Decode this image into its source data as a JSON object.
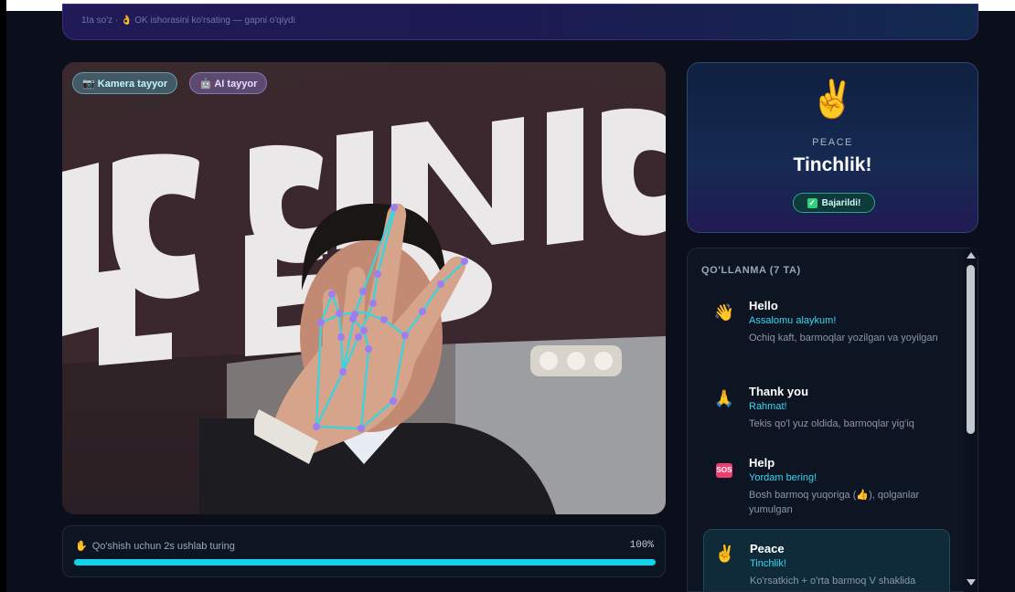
{
  "banner": {
    "text": "1ta so'z · 👌 OK ishorasini ko'rsating — gapni o'qiydi"
  },
  "camera": {
    "status_camera": "📷 Kamera tayyor",
    "status_ai": "🤖 AI tayyor"
  },
  "hold": {
    "icon": "✋",
    "label": "Qo'shish uchun 2s ushlab turing",
    "percent_text": "100%",
    "progress": 1.0,
    "bar_color": "#10d4ea"
  },
  "result": {
    "emoji": "✌️",
    "english": "PEACE",
    "uzbek": "Tinchlik!",
    "badge": "Bajarildi!"
  },
  "guide": {
    "title": "QO'LLANMA (7 TA)",
    "items": [
      {
        "icon": "👋",
        "english": "Hello",
        "uzbek": "Assalomu alaykum!",
        "desc": "Ochiq kaft, barmoqlar yozilgan va yoyilgan"
      },
      {
        "icon": "🙏",
        "english": "Thank you",
        "uzbek": "Rahmat!",
        "desc": "Tekis qo'l yuz oldida, barmoqlar yig'iq"
      },
      {
        "icon": "SOS",
        "english": "Help",
        "uzbek": "Yordam bering!",
        "desc": "Bosh barmoq yuqoriga (👍), qolganlar yumulgan"
      },
      {
        "icon": "✌️",
        "english": "Peace",
        "uzbek": "Tinchlik!",
        "desc": "Ko'rsatkich + o'rta barmoq V shaklida"
      }
    ]
  },
  "colors": {
    "accent": "#10d4ea",
    "success": "#2fd07a",
    "sos": "#ee3e6d"
  }
}
